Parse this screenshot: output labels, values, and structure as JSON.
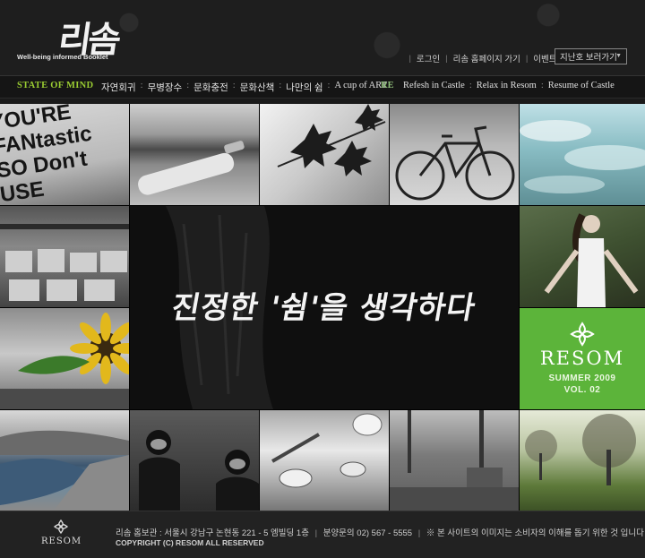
{
  "header": {
    "logo_text": "리솜",
    "logo_subtitle": "Well-being informed Booklet",
    "links": [
      "로그인",
      "리솜 홈페이지 가기",
      "이벤트"
    ],
    "archive_select": "지난호 보러가기"
  },
  "menubar": {
    "left_section": "STATE OF MIND",
    "left_items": [
      "자연회귀",
      "무병장수",
      "문화충전",
      "문화산책",
      "나만의 쉼",
      "A cup of ART"
    ],
    "right_section": "RE",
    "right_items": [
      "Refesh in Castle",
      "Relax in Resom",
      "Resume of Castle"
    ]
  },
  "sign_tile": {
    "text": "YOU'RE\nFANtastic\nSO Don't\nUSE"
  },
  "main_banner": {
    "slogan": "진정한 '쉼'을 생각하다"
  },
  "resom_tile": {
    "brand": "RESOM",
    "season": "SUMMER 2009",
    "volume": "VOL. 02",
    "accent": "#5cb43a"
  },
  "footer": {
    "logo_word": "RESOM",
    "address": "리솜 홈보관 : 서울시 강남구 논현동 221 - 5 엠빌딩 1층",
    "phone": "분양문의  02) 567 - 5555",
    "notice": "※  본 사이트의 이미지는 소비자의 이해를 돕기 위한 것 입니다",
    "copyright": "COPYRIGHT (C) RESOM ALL RESERVED"
  }
}
